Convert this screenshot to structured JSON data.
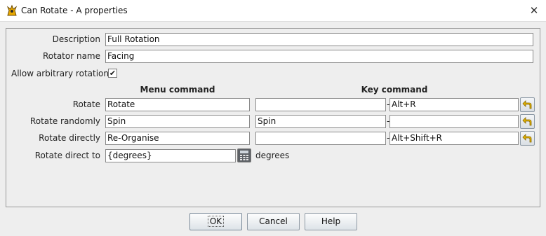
{
  "window": {
    "title": "Can Rotate - A properties",
    "app_icon": "pawn-icon",
    "close_glyph": "✕"
  },
  "form": {
    "description_label": "Description",
    "description_value": "Full Rotation",
    "rotator_label": "Rotator name",
    "rotator_value": "Facing",
    "arbitrary_label": "Allow arbitrary rotations",
    "arbitrary_checked": true,
    "arbitrary_check_glyph": "✔",
    "menu_header": "Menu command",
    "key_header": "Key command",
    "rows": [
      {
        "label": "Rotate",
        "menu": "Rotate",
        "key_name": "",
        "key_sep": "-",
        "key_value": "Alt+R"
      },
      {
        "label": "Rotate randomly",
        "menu": "Spin",
        "key_name": "Spin",
        "key_sep": "-",
        "key_value": ""
      },
      {
        "label": "Rotate directly",
        "menu": "Re-Organise",
        "key_name": "",
        "key_sep": "-",
        "key_value": "Alt+Shift+R"
      }
    ],
    "direct_label": "Rotate direct to",
    "direct_value": "{degrees}",
    "direct_unit": "degrees"
  },
  "buttons": {
    "ok": "OK",
    "cancel": "Cancel",
    "help": "Help"
  },
  "colors": {
    "window_bg": "#eeeeee",
    "undo_arrow": "#e0b000",
    "calculator": "#5d6166"
  }
}
